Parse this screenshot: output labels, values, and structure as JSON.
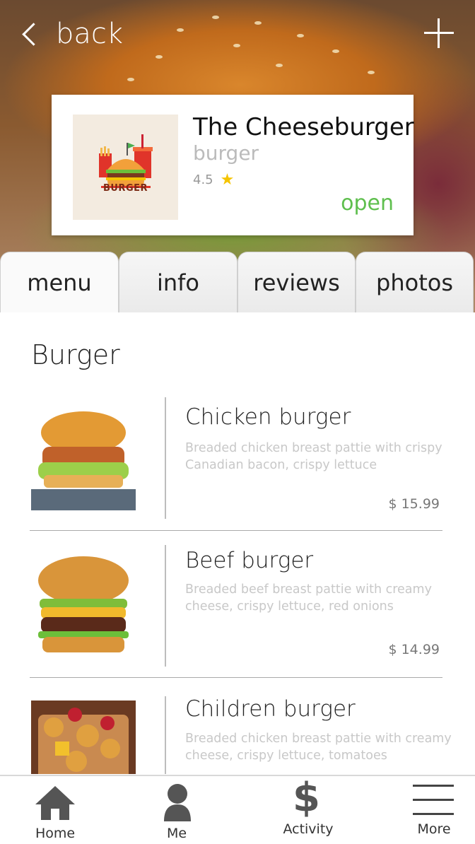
{
  "header": {
    "back_label": "back",
    "add_icon": "plus-icon"
  },
  "restaurant": {
    "name": "The Cheeseburger",
    "category": "burger",
    "rating": "4.5",
    "status": "open",
    "logo_text": "BURGER",
    "status_color": "#5fbf4e",
    "rating_star_color": "#f5c400"
  },
  "tabs": [
    {
      "label": "menu"
    },
    {
      "label": "info"
    },
    {
      "label": "reviews"
    },
    {
      "label": "photos"
    }
  ],
  "menu": {
    "section_title": "Burger",
    "items": [
      {
        "name": "Chicken burger",
        "description": "Breaded chicken breast pattie with crispy Canadian bacon, crispy lettuce",
        "price": "$ 15.99"
      },
      {
        "name": "Beef burger",
        "description": "Breaded beef breast pattie with creamy cheese, crispy lettuce, red onions",
        "price": "$ 14.99"
      },
      {
        "name": "Children burger",
        "description": "Breaded chicken breast pattie with creamy cheese, crispy lettuce, tomatoes",
        "price": ""
      }
    ]
  },
  "bottom_nav": [
    {
      "label": "Home",
      "icon": "home-icon"
    },
    {
      "label": "Me",
      "icon": "person-icon"
    },
    {
      "label": "Activity",
      "icon": "dollar-icon"
    },
    {
      "label": "More",
      "icon": "menu-icon"
    }
  ]
}
